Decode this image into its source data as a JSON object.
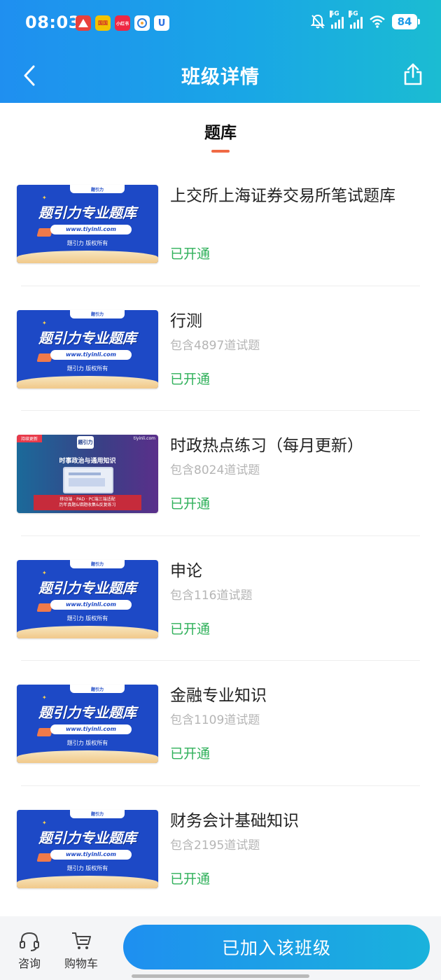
{
  "status_bar": {
    "time": "08:03",
    "app_icons": [
      {
        "name": "app-icon-red",
        "text": "",
        "color": "#e8413c"
      },
      {
        "name": "app-icon-yellow",
        "text": "国国",
        "color": "#f2c200"
      },
      {
        "name": "app-icon-pink",
        "text": "小红书",
        "color": "#ee2844"
      },
      {
        "name": "app-icon-chat",
        "text": "",
        "color": "#ffffff"
      },
      {
        "name": "app-icon-blue",
        "text": "U",
        "color": "#ffffff"
      }
    ],
    "signal_1": "5G",
    "signal_2": "5G",
    "battery": "84"
  },
  "header": {
    "title": "班级详情"
  },
  "section": {
    "tab_label": "题库"
  },
  "thumb_text": {
    "brand_chip": "题引力",
    "headline": "题引力专业题库",
    "url": "www.tiyinli.com",
    "copyright": "题引力 版权所有"
  },
  "news_thumb_text": {
    "badge": "持续更新",
    "site": "tiyinli.com",
    "mark": "题引力",
    "heading": "时事政治与通用知识",
    "banner_line1": "移动端 · PAD · PC端三端适配",
    "banner_line2": "历年真题&错题收集&反复练习"
  },
  "items": [
    {
      "title": "上交所上海证券交易所笔试题库",
      "count": "",
      "status": "已开通"
    },
    {
      "title": "行测",
      "count": "包含4897道试题",
      "status": "已开通"
    },
    {
      "title": "时政热点练习（每月更新）",
      "count": "包含8024道试题",
      "status": "已开通"
    },
    {
      "title": "申论",
      "count": "包含116道试题",
      "status": "已开通"
    },
    {
      "title": "金融专业知识",
      "count": "包含1109道试题",
      "status": "已开通"
    },
    {
      "title": "财务会计基础知识",
      "count": "包含2195道试题",
      "status": "已开通"
    }
  ],
  "bottom_bar": {
    "consult_label": "咨询",
    "cart_label": "购物车",
    "join_label": "已加入该班级"
  },
  "colors": {
    "header_gradient_start": "#1f8ff0",
    "header_gradient_end": "#1bbcd2",
    "accent_underline": "#f06a45",
    "status_green": "#2fb05a",
    "count_gray": "#b5b5b5"
  }
}
